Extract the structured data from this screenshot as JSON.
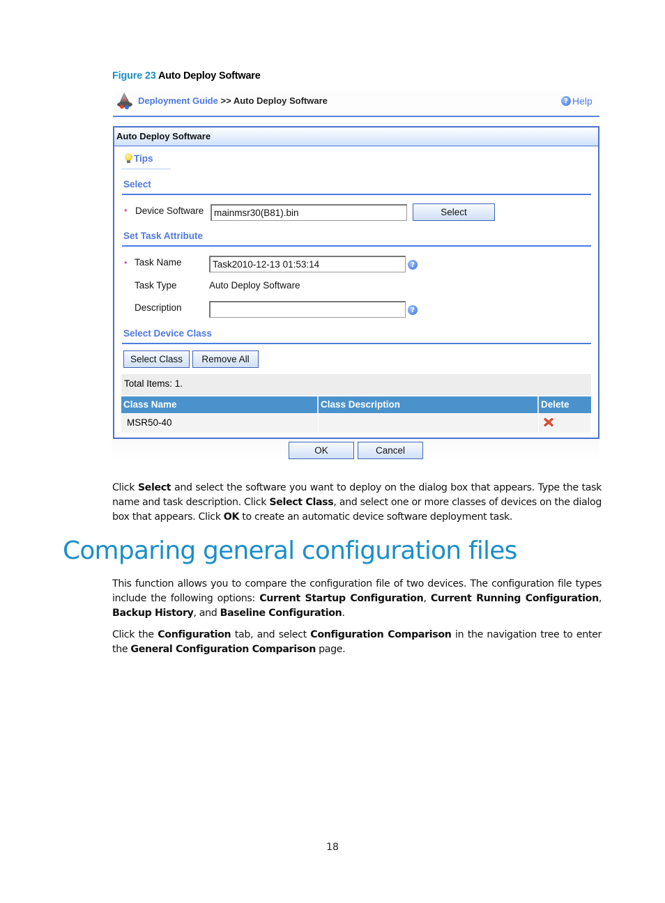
{
  "figure": {
    "number": "Figure 23",
    "title": "Auto Deploy Software"
  },
  "breadcrumb": {
    "link": "Deployment Guide",
    "separator": ">>",
    "current": "Auto Deploy Software",
    "help_label": "Help"
  },
  "panel": {
    "title": "Auto Deploy Software",
    "tips_label": "Tips",
    "sections": {
      "select": "Select",
      "task_attribute": "Set Task Attribute",
      "device_class": "Select Device Class"
    },
    "fields": {
      "device_software": {
        "label": "Device Software",
        "value": "mainmsr30(B81).bin",
        "required_mark": "*"
      },
      "task_name": {
        "label": "Task Name",
        "value": "Task2010-12-13 01:53:14",
        "required_mark": "*"
      },
      "task_type": {
        "label": "Task Type",
        "value": "Auto Deploy Software"
      },
      "description": {
        "label": "Description",
        "value": ""
      }
    },
    "buttons": {
      "select": "Select",
      "select_class": "Select Class",
      "remove_all": "Remove All",
      "ok": "OK",
      "cancel": "Cancel"
    },
    "total_items": "Total Items: 1.",
    "table": {
      "columns": [
        "Class Name",
        "Class Description",
        "Delete"
      ],
      "rows": [
        {
          "class_name": "MSR50-40",
          "class_description": "",
          "delete_icon": "delete-x-icon"
        }
      ]
    }
  },
  "paragraphs": {
    "p1": [
      {
        "t": "Click "
      },
      {
        "b": "Select"
      },
      {
        "t": " and select the software you want to deploy on the dialog box that appears. Type the task name and task description. Click "
      },
      {
        "b": "Select Class"
      },
      {
        "t": ", and select one or more classes of devices on the dialog box that appears. Click "
      },
      {
        "b": "OK"
      },
      {
        "t": " to create an automatic device software deployment task."
      }
    ],
    "heading": "Comparing general configuration files",
    "p2": [
      {
        "t": "This function allows you to compare the configuration file of two devices. The configuration file types include the following options: "
      },
      {
        "b": "Current Startup Configuration"
      },
      {
        "t": ", "
      },
      {
        "b": "Current Running Configuration"
      },
      {
        "t": ", "
      },
      {
        "b": "Backup History"
      },
      {
        "t": ", and "
      },
      {
        "b": "Baseline Configuration"
      },
      {
        "t": "."
      }
    ],
    "p3": [
      {
        "t": "Click the "
      },
      {
        "b": "Configuration"
      },
      {
        "t": " tab, and select "
      },
      {
        "b": "Configuration Comparison"
      },
      {
        "t": " in the navigation tree to enter the "
      },
      {
        "b": "General Configuration Comparison"
      },
      {
        "t": " page."
      }
    ]
  },
  "page_number": "18"
}
